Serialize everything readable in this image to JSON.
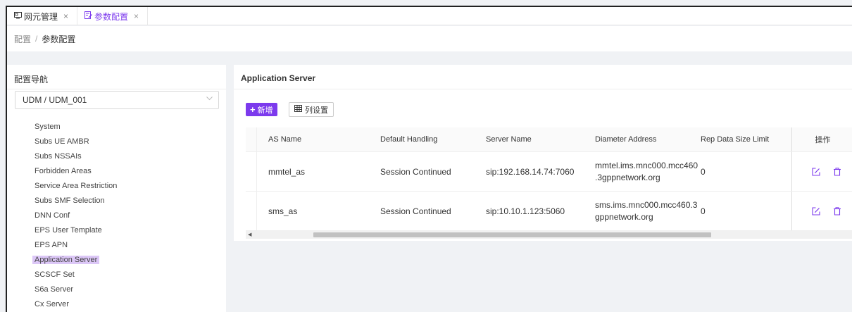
{
  "tabs": [
    {
      "icon": "monitor-icon",
      "label": "网元管理",
      "close": "×"
    },
    {
      "icon": "config-doc-icon",
      "label": "参数配置",
      "close": "×"
    }
  ],
  "breadcrumb": {
    "parent": "配置",
    "separator": "/",
    "current": "参数配置"
  },
  "left_panel": {
    "title": "配置导航",
    "select_value": "UDM / UDM_001",
    "nav_items": [
      "System",
      "Subs UE AMBR",
      "Subs NSSAIs",
      "Forbidden Areas",
      "Service Area Restriction",
      "Subs SMF Selection",
      "DNN Conf",
      "EPS User Template",
      "EPS APN",
      "Application Server",
      "SCSCF Set",
      "S6a Server",
      "Cx Server"
    ],
    "active_item": "Application Server"
  },
  "main": {
    "title": "Application Server",
    "add_button": "新增",
    "columns_button": "列设置",
    "table": {
      "headers": [
        "AS Name",
        "Default Handling",
        "Server Name",
        "Diameter Address",
        "Rep Data Size Limit",
        "操作"
      ],
      "rows": [
        {
          "as_name": "mmtel_as",
          "default_handling": "Session Continued",
          "server_name": "sip:192.168.14.74:7060",
          "diameter_line1": "mmtel.ims.mnc000.mcc460",
          "diameter_line2": ".3gppnetwork.org",
          "rep_limit": "0"
        },
        {
          "as_name": "sms_as",
          "default_handling": "Session Continued",
          "server_name": "sip:10.10.1.123:5060",
          "diameter_line1": "sms.ims.mnc000.mcc460.3",
          "diameter_line2": "gppnetwork.org",
          "rep_limit": "0"
        }
      ]
    }
  },
  "colors": {
    "accent": "#7c3aed",
    "active_nav_bg": "#dcc7f7"
  }
}
